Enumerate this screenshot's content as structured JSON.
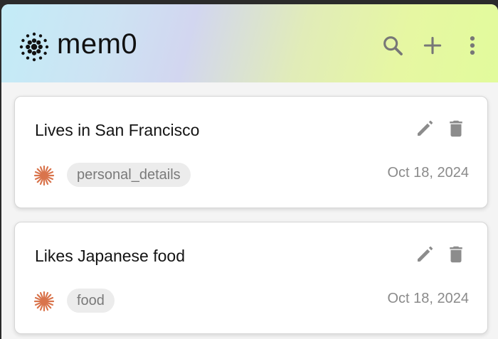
{
  "app": {
    "brand": "mem0"
  },
  "header": {
    "actions": [
      {
        "icon": "search-icon"
      },
      {
        "icon": "plus-icon"
      },
      {
        "icon": "more-vert-icon"
      }
    ]
  },
  "memories": [
    {
      "text": "Lives in San Francisco",
      "category": "personal_details",
      "date": "Oct 18, 2024"
    },
    {
      "text": "Likes Japanese food",
      "category": "food",
      "date": "Oct 18, 2024"
    }
  ],
  "colors": {
    "accent_spark": "#d9744c",
    "icon_gray": "#8c8c8c",
    "header_gradient_start": "#c3ecf7",
    "header_gradient_end": "#e2fb9c"
  },
  "icons": {
    "edit": "pencil-icon",
    "delete": "trash-icon",
    "category": "sparkle-icon"
  }
}
